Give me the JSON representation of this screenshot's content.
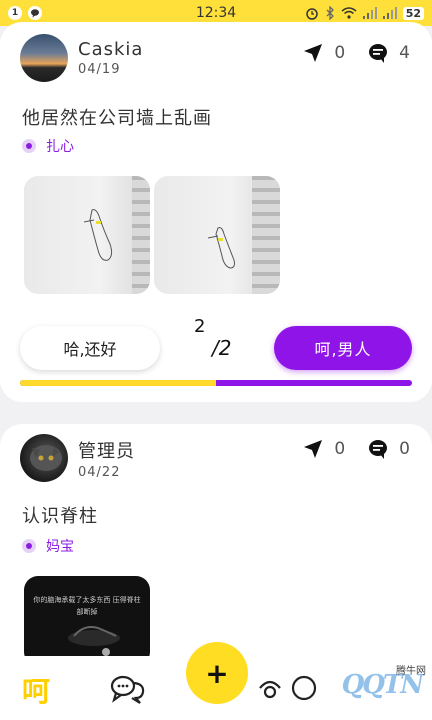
{
  "status_bar": {
    "left_badges": [
      "1"
    ],
    "time": "12:34",
    "battery": "52"
  },
  "posts": [
    {
      "username": "Caskia",
      "date": "04/19",
      "shares": "0",
      "comments": "4",
      "text": "他居然在公司墙上乱画",
      "tag": "扎心",
      "vote": {
        "left_label": "哈,还好",
        "right_label": "呵,男人",
        "page_current": "2",
        "page_total": "/2",
        "left_fraction": 0.5
      }
    },
    {
      "username": "管理员",
      "date": "04/22",
      "shares": "0",
      "comments": "0",
      "text": "认识脊柱",
      "tag": "妈宝",
      "image_caption": "你的脑海承载了太多东西 压得脊柱部断掉"
    }
  ],
  "bottom_nav": {
    "home_label": "呵",
    "add_label": "+",
    "watermark_text": "腾牛网",
    "watermark_logo": "QQTN"
  },
  "colors": {
    "accent_yellow": "#ffd92b",
    "accent_purple": "#8f14e8"
  }
}
